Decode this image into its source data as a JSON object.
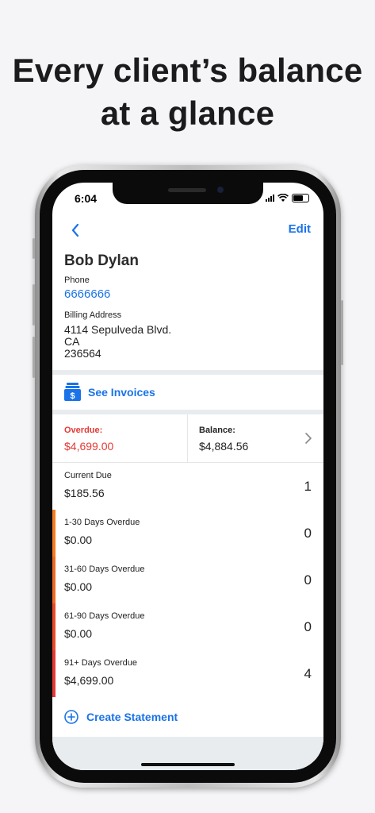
{
  "headline": {
    "line1": "Every client’s balance",
    "line2": "at a glance"
  },
  "status_bar": {
    "time": "6:04"
  },
  "nav": {
    "edit_label": "Edit"
  },
  "client": {
    "name": "Bob Dylan",
    "phone_label": "Phone",
    "phone": "6666666",
    "billing_label": "Billing Address",
    "billing_address": "4114 Sepulveda Blvd.\nCA\n236564"
  },
  "invoices": {
    "label": "See Invoices"
  },
  "summary": {
    "overdue_label": "Overdue:",
    "overdue_amount": "$4,699.00",
    "balance_label": "Balance:",
    "balance_amount": "$4,884.56"
  },
  "aging": [
    {
      "label": "Current Due",
      "amount": "$185.56",
      "count": "1",
      "color": ""
    },
    {
      "label": "1-30 Days Overdue",
      "amount": "$0.00",
      "count": "0",
      "color": "#f57c1f"
    },
    {
      "label": "31-60 Days Overdue",
      "amount": "$0.00",
      "count": "0",
      "color": "#f06a25"
    },
    {
      "label": "61-90 Days Overdue",
      "amount": "$0.00",
      "count": "0",
      "color": "#ea4a2a"
    },
    {
      "label": "91+ Days Overdue",
      "amount": "$4,699.00",
      "count": "4",
      "color": "#e53935"
    }
  ],
  "create_statement": {
    "label": "Create Statement"
  },
  "colors": {
    "accent": "#1a73e8",
    "overdue": "#e53935"
  }
}
